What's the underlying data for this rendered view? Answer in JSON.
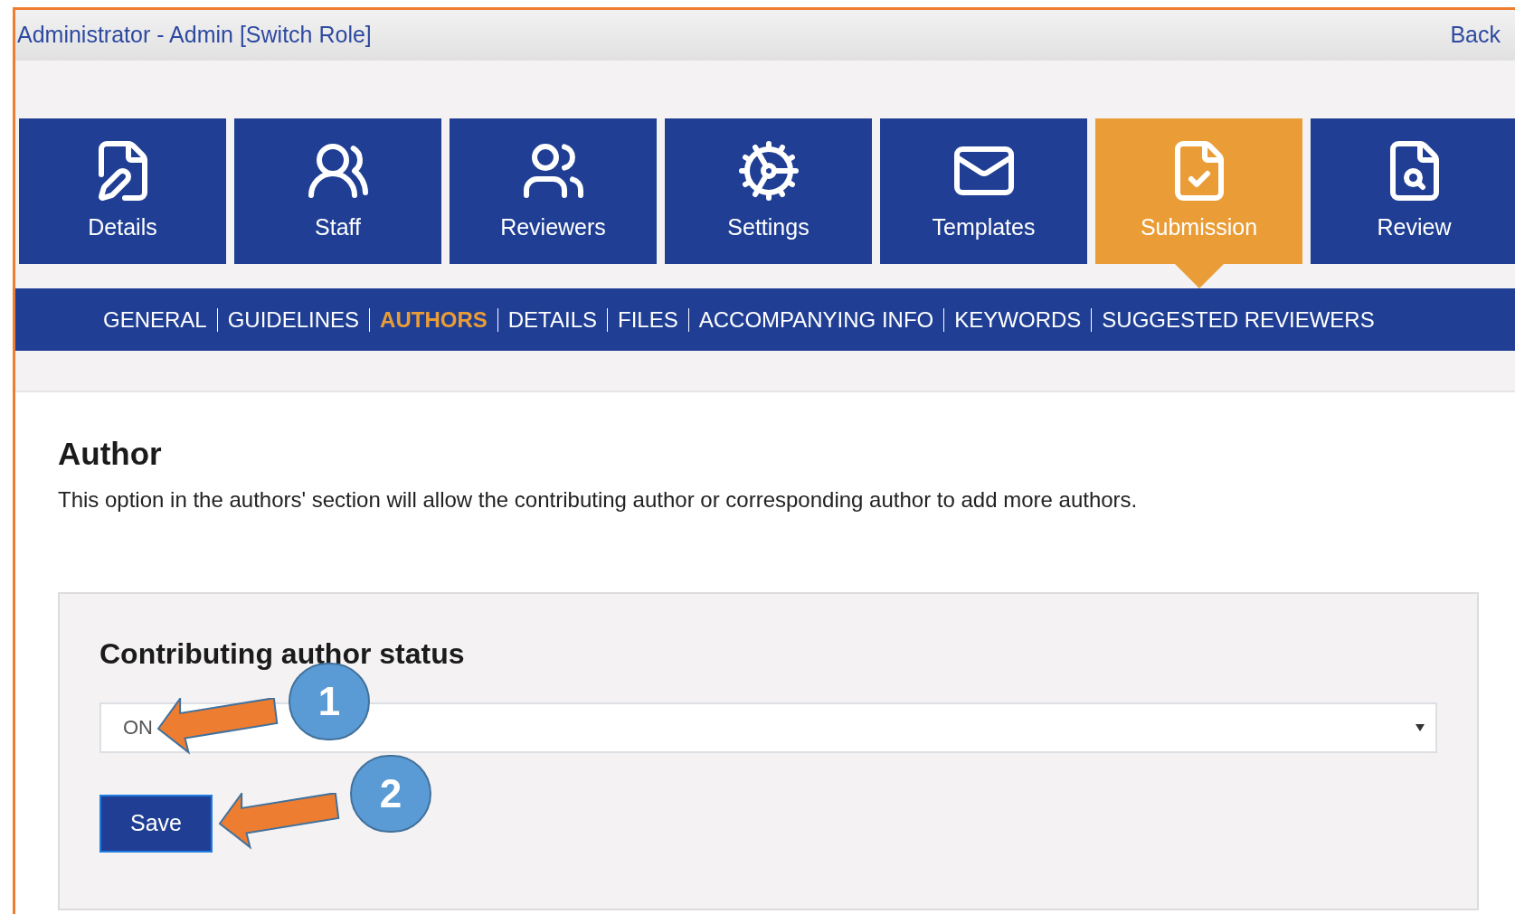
{
  "top_bar": {
    "user": "Administrator - Admin [Switch Role]",
    "back": "Back"
  },
  "tiles": [
    {
      "label": "Details",
      "selected": false
    },
    {
      "label": "Staff",
      "selected": false
    },
    {
      "label": "Reviewers",
      "selected": false
    },
    {
      "label": "Settings",
      "selected": false
    },
    {
      "label": "Templates",
      "selected": false
    },
    {
      "label": "Submission",
      "selected": true
    },
    {
      "label": "Review",
      "selected": false
    }
  ],
  "subnav": [
    {
      "label": "GENERAL",
      "selected": false
    },
    {
      "label": "GUIDELINES",
      "selected": false
    },
    {
      "label": "AUTHORS",
      "selected": true
    },
    {
      "label": "DETAILS",
      "selected": false
    },
    {
      "label": "FILES",
      "selected": false
    },
    {
      "label": "ACCOMPANYING INFO",
      "selected": false
    },
    {
      "label": "KEYWORDS",
      "selected": false
    },
    {
      "label": "SUGGESTED REVIEWERS",
      "selected": false
    }
  ],
  "section": {
    "title": "Author",
    "description": "This option in the authors' section will allow the contributing author or corresponding author to add more authors."
  },
  "panel": {
    "title": "Contributing author status",
    "select_value": "ON",
    "save": "Save"
  },
  "annotations": [
    {
      "label": "1"
    },
    {
      "label": "2"
    }
  ]
}
